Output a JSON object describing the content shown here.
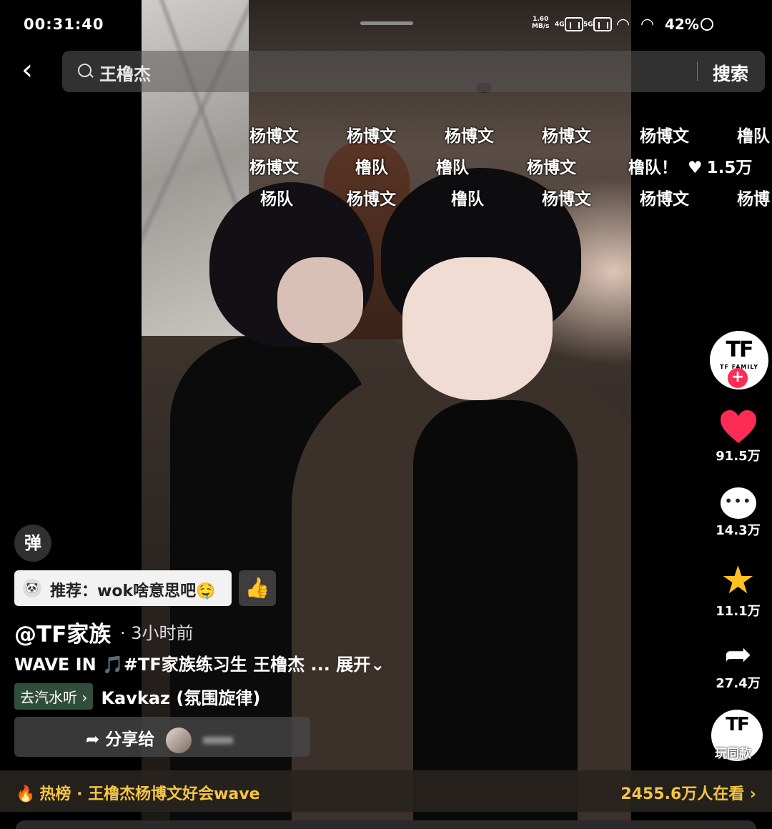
{
  "status": {
    "time": "00:31:40",
    "net_speed_value": "1.60",
    "net_speed_unit": "MB/s",
    "signal_1_label": "4G",
    "signal_2_label": "5G",
    "battery": "42%"
  },
  "search": {
    "value": "王橹杰",
    "button_label": "搜索"
  },
  "danmaku": [
    "杨博文",
    "杨博文",
    "杨博文",
    "杨博文",
    "杨博文",
    "橹队",
    "杨博文",
    "橹队",
    "橹队",
    "杨博文",
    "橹队！",
    "杨队",
    "杨博文",
    "橹队",
    "杨博文",
    "杨博文",
    "杨博"
  ],
  "danmaku_like": "1.5万",
  "rail": {
    "author_avatar_logo": "TF",
    "author_avatar_caption": "TF FAMILY",
    "like_count": "91.5万",
    "comment_count": "14.3万",
    "favorite_count": "11.1万",
    "share_count": "27.4万",
    "music_disc_label": "玩同款"
  },
  "info": {
    "danmaku_toggle": "弹",
    "recommend_text": "推荐：wok啥意思吧🤤",
    "author": "@TF家族",
    "time": "· 3小时前",
    "caption": "WAVE IN 🎵#TF家族练习生 王橹杰 ... ",
    "expand_label": "展开⌄",
    "qishui_label": "去汽水听 ›",
    "music_title": "Kavkaz (氛围旋律)",
    "share_label": "分享给"
  },
  "hotbar": {
    "left": "热榜 · 王橹杰杨博文好会wave",
    "right": "2455.6万人在看 ›"
  },
  "colors": {
    "accent_like": "#fe2c55",
    "star": "#ffc11f",
    "hot_text": "#f5c542"
  }
}
